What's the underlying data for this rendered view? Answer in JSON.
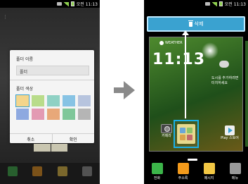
{
  "left_screen": {
    "status": {
      "time": "오전 11:13"
    },
    "dialog": {
      "name_label": "폴더 이름",
      "name_value": "폴더",
      "color_label": "폴더 색상",
      "swatches": [
        "#f4d58b",
        "#b9dc8a",
        "#8fd1c4",
        "#87c3e4",
        "#b7c4de",
        "#8ea9e0",
        "#e39ab3",
        "#e8a879",
        "#7fc79a",
        "#b5b5b5"
      ],
      "cancel_label": "취소",
      "ok_label": "확인"
    }
  },
  "right_screen": {
    "status": {
      "time": "오전 11:13"
    },
    "delete_bar": {
      "label": "삭제"
    },
    "weather": {
      "logo": "WEATHER",
      "time": "11:13",
      "message_line1": "도시를 추가하려면",
      "message_line2": "터치하세요"
    },
    "apps": {
      "camera_label": "카메라",
      "play_label": "Play 스토어"
    },
    "dock": [
      {
        "label": "전화",
        "color": "#3cb54a"
      },
      {
        "label": "주소록",
        "color": "#f39a1b"
      },
      {
        "label": "메시지",
        "color": "#f2c744"
      },
      {
        "label": "메뉴",
        "color": "#9a9a9a"
      }
    ]
  },
  "colors": {
    "accent": "#3aa2d0",
    "highlight": "#1ab0e8",
    "arrow": "#8a8a8a"
  }
}
